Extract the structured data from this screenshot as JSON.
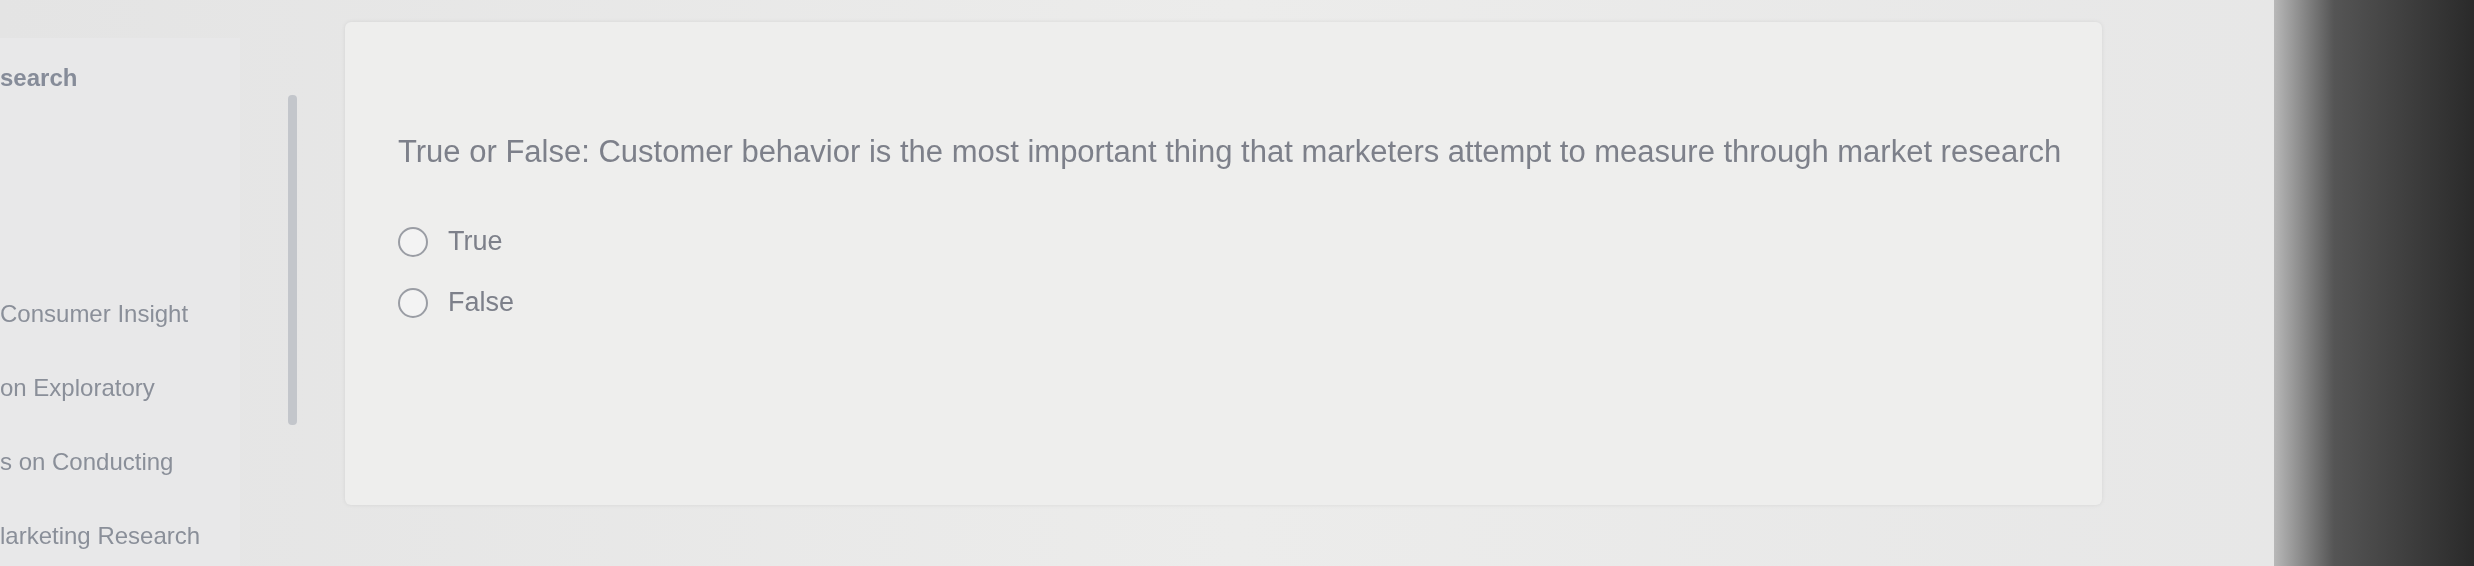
{
  "sidebar": {
    "items": [
      {
        "label": "search"
      },
      {
        "label": "Consumer Insight"
      },
      {
        "label": "on Exploratory"
      },
      {
        "label": "s on Conducting"
      },
      {
        "label": "larketing Research"
      }
    ]
  },
  "question": {
    "text": "True or False: Customer behavior is the most important thing that marketers attempt to measure through market research",
    "options": [
      {
        "label": "True",
        "selected": false
      },
      {
        "label": "False",
        "selected": false
      }
    ]
  }
}
